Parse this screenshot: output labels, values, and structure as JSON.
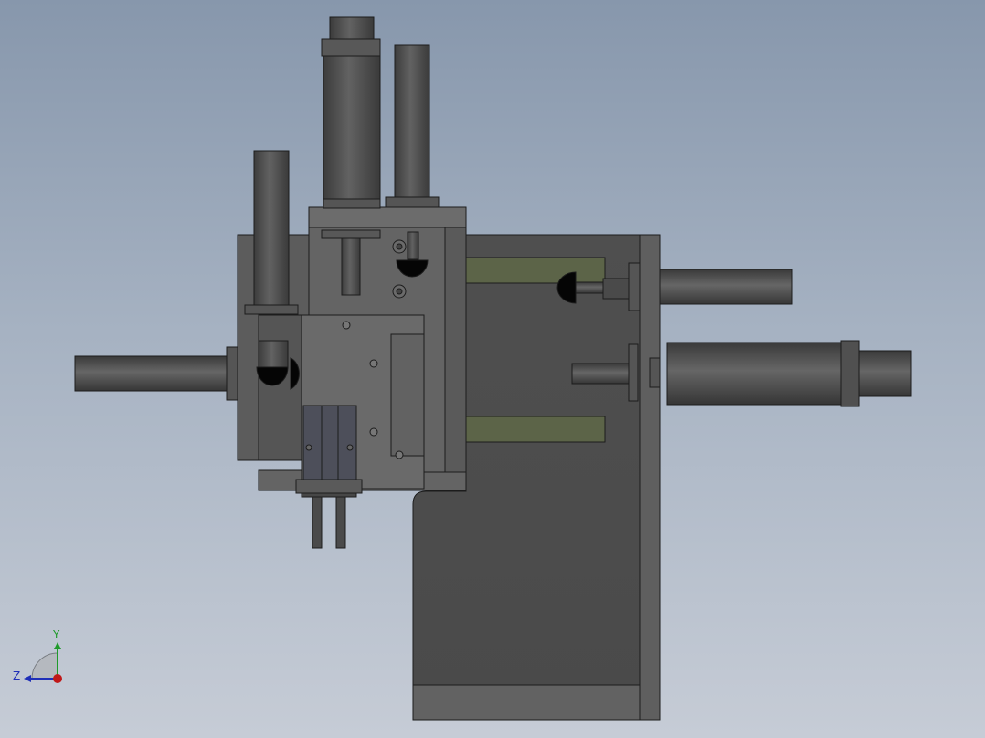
{
  "viewport": {
    "background_top": "#8797ac",
    "background_bottom": "#c6ccd6"
  },
  "model": {
    "colors": {
      "body": "#4b4b4b",
      "frame": "#5f5f5f",
      "block": "#6a6a6a",
      "slot": "#5c6448",
      "outline": "#1c1c1c",
      "cylinder_light": "#6e6e6e",
      "cylinder_dark": "#3a3a3a",
      "rail": "#4d4f5a"
    }
  },
  "triad": {
    "y_label": "Y",
    "z_label": "Z",
    "y_color": "#1f9a2a",
    "z_color": "#1f2fb8",
    "x_color": "#c01818"
  }
}
